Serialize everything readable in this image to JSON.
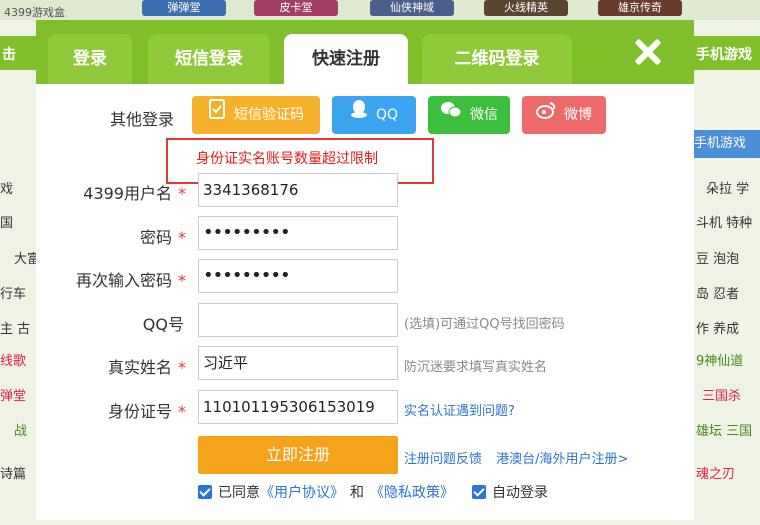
{
  "background": {
    "site_label": "4399游戏盒",
    "thumbs": [
      "弹弹堂",
      "皮卡堂",
      "仙侠神域",
      "火线精英",
      "雄京传奇"
    ],
    "green_bar_left": "击",
    "green_bar_right": "手机游戏",
    "right_tab": "手机游戏",
    "left_items": [
      "戏",
      "国",
      "大富",
      "行车",
      "主 古",
      "线歌",
      "弹堂",
      "战",
      "诗篇"
    ],
    "right_items": [
      "朵拉 学",
      "斗机 特种",
      "豆 泡泡",
      "岛 忍者",
      "作 养成",
      "9神仙道",
      "三国杀",
      "雄坛 三国",
      "魂之刃"
    ]
  },
  "tabs": [
    {
      "label": "登录"
    },
    {
      "label": "短信登录"
    },
    {
      "label": "快速注册"
    },
    {
      "label": "二维码登录"
    }
  ],
  "other_login": {
    "label": "其他登录",
    "buttons": [
      {
        "label": "短信验证码",
        "color": "#f6b12a"
      },
      {
        "label": "QQ",
        "color": "#3aa4f0"
      },
      {
        "label": "微信",
        "color": "#3cbf3c"
      },
      {
        "label": "微博",
        "color": "#ee6a6a"
      }
    ]
  },
  "error": "身份证实名账号数量超过限制",
  "form": {
    "username": {
      "label": "4399用户名",
      "value": "3341368176"
    },
    "password": {
      "label": "密码",
      "value": "•••••••••"
    },
    "password_confirm": {
      "label": "再次输入密码",
      "value": "•••••••••"
    },
    "qq": {
      "label": "QQ号",
      "value": "",
      "hint": "(选填)可通过QQ号找回密码"
    },
    "real_name": {
      "label": "真实姓名",
      "value": "习近平",
      "hint": "防沉迷要求填写真实姓名"
    },
    "id_number": {
      "label": "身份证号",
      "value": "110101195306153019",
      "hint": "实名认证遇到问题?"
    }
  },
  "submit_label": "立即注册",
  "links": {
    "feedback": "注册问题反馈",
    "overseas": "港澳台/海外用户注册>"
  },
  "agreement": {
    "agreed_prefix": "已同意",
    "user_agreement": "《用户协议》",
    "and": "和",
    "privacy": "《隐私政策》",
    "auto_login": "自动登录"
  },
  "colors": {
    "header_green": "#7fbf2a",
    "submit_orange": "#f6a21a",
    "error_red": "#e21b1b",
    "link_blue": "#2e73c7"
  }
}
